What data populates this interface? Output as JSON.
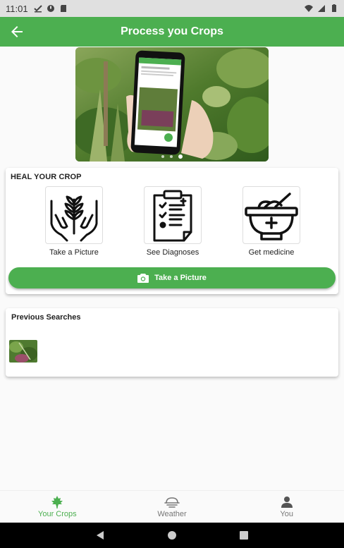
{
  "status_bar": {
    "time": "11:01"
  },
  "app_bar": {
    "title": "Process you Crops"
  },
  "hero": {
    "slide_count": 3,
    "active_slide": 3
  },
  "heal": {
    "title": "HEAL YOUR CROP",
    "steps": [
      {
        "label": "Take a Picture",
        "icon": "hands-plant-icon"
      },
      {
        "label": "See Diagnoses",
        "icon": "clipboard-checklist-icon"
      },
      {
        "label": "Get medicine",
        "icon": "mortar-pestle-icon"
      }
    ],
    "cta_label": "Take a Picture"
  },
  "previous": {
    "title": "Previous Searches"
  },
  "bottom_nav": {
    "items": [
      {
        "label": "Your Crops",
        "icon": "leaf-icon",
        "active": true
      },
      {
        "label": "Weather",
        "icon": "weather-icon",
        "active": false
      },
      {
        "label": "You",
        "icon": "person-icon",
        "active": false
      }
    ]
  },
  "colors": {
    "primary": "#4caf50",
    "status_bar": "#e0e0e0"
  }
}
